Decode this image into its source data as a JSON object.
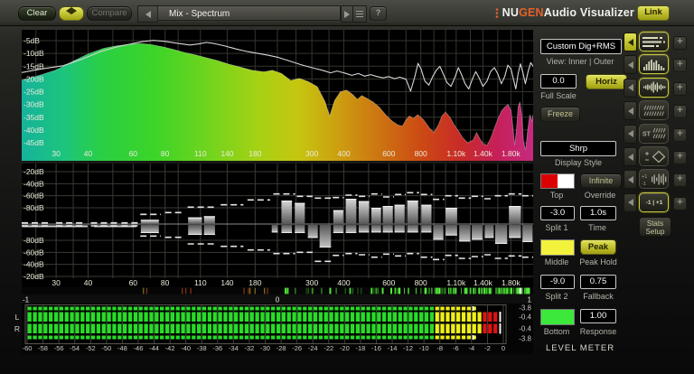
{
  "topbar": {
    "clear": "Clear",
    "compare": "Compare",
    "preset": "Mix - Spectrum",
    "help": "?",
    "brand_prefix": "NU",
    "brand_accent": "GEN",
    "brand_suffix": " Audio Visualizer",
    "link": "Link"
  },
  "freq_axis": {
    "grid": [
      25,
      30,
      35,
      40,
      50,
      60,
      70,
      80,
      90,
      110,
      140,
      180,
      220,
      260,
      300,
      350,
      400,
      500,
      600,
      700,
      800,
      900,
      1000,
      1100,
      1250,
      1400,
      1600,
      1800,
      2000
    ],
    "labels": [
      [
        30,
        "30"
      ],
      [
        40,
        "40"
      ],
      [
        60,
        "60"
      ],
      [
        80,
        "80"
      ],
      [
        110,
        "110"
      ],
      [
        140,
        "140"
      ],
      [
        180,
        "180"
      ],
      [
        300,
        "300"
      ],
      [
        400,
        "400"
      ],
      [
        600,
        "600"
      ],
      [
        800,
        "800"
      ],
      [
        1100,
        "1.10k"
      ],
      [
        1400,
        "1.40k"
      ],
      [
        1800,
        "1.80k"
      ]
    ]
  },
  "spectrum": {
    "db_labels": [
      [
        -5,
        "-5dB"
      ],
      [
        -10,
        "-10dB"
      ],
      [
        -15,
        "-15dB"
      ],
      [
        -20,
        "-20dB"
      ],
      [
        -25,
        "-25dB"
      ],
      [
        -30,
        "-30dB"
      ],
      [
        -35,
        "-35dB"
      ],
      [
        -40,
        "-40dB"
      ],
      [
        -45,
        "-45dB"
      ]
    ],
    "gradient": [
      [
        0,
        "#16b29c"
      ],
      [
        0.08,
        "#1cc47e"
      ],
      [
        0.16,
        "#2ad042"
      ],
      [
        0.26,
        "#3cd428"
      ],
      [
        0.36,
        "#6ed41e"
      ],
      [
        0.46,
        "#a4d214"
      ],
      [
        0.54,
        "#c6c610"
      ],
      [
        0.62,
        "#cc9e10"
      ],
      [
        0.7,
        "#cc7412"
      ],
      [
        0.78,
        "#cc4a14"
      ],
      [
        0.86,
        "#c82a28"
      ],
      [
        0.93,
        "#c6205a"
      ],
      [
        1,
        "#c62a80"
      ]
    ],
    "fill_points": [
      [
        22,
        -20.5
      ],
      [
        26,
        -18.5
      ],
      [
        30,
        -16.5
      ],
      [
        35,
        -13
      ],
      [
        40,
        -10.2
      ],
      [
        46,
        -8
      ],
      [
        52,
        -7
      ],
      [
        58,
        -6.4
      ],
      [
        64,
        -6.1
      ],
      [
        70,
        -6.5
      ],
      [
        78,
        -7.4
      ],
      [
        86,
        -8.4
      ],
      [
        95,
        -9.6
      ],
      [
        105,
        -10.6
      ],
      [
        115,
        -11.6
      ],
      [
        128,
        -12.8
      ],
      [
        142,
        -14.2
      ],
      [
        158,
        -15.4
      ],
      [
        175,
        -16.6
      ],
      [
        195,
        -17.2
      ],
      [
        210,
        -16.6
      ],
      [
        228,
        -17.8
      ],
      [
        248,
        -20.6
      ],
      [
        268,
        -19.8
      ],
      [
        290,
        -21
      ],
      [
        315,
        -23
      ],
      [
        338,
        -29
      ],
      [
        352,
        -34.5
      ],
      [
        368,
        -28.5
      ],
      [
        388,
        -25
      ],
      [
        410,
        -24.4
      ],
      [
        432,
        -26
      ],
      [
        452,
        -28
      ],
      [
        470,
        -26.5
      ],
      [
        492,
        -27.6
      ],
      [
        520,
        -29
      ],
      [
        550,
        -31
      ],
      [
        582,
        -34
      ],
      [
        618,
        -36.5
      ],
      [
        650,
        -38
      ],
      [
        678,
        -38.5
      ],
      [
        700,
        -36
      ],
      [
        722,
        -34.5
      ],
      [
        748,
        -35.5
      ],
      [
        778,
        -34
      ],
      [
        820,
        -36
      ],
      [
        862,
        -39
      ],
      [
        900,
        -41
      ],
      [
        938,
        -38
      ],
      [
        968,
        -34.5
      ],
      [
        1000,
        -33
      ],
      [
        1040,
        -35
      ],
      [
        1080,
        -38
      ],
      [
        1125,
        -40.5
      ],
      [
        1165,
        -43
      ],
      [
        1220,
        -45
      ],
      [
        1280,
        -44
      ],
      [
        1322,
        -41
      ],
      [
        1362,
        -43.5
      ],
      [
        1405,
        -45.5
      ],
      [
        1455,
        -46
      ],
      [
        1505,
        -43
      ],
      [
        1555,
        -39
      ],
      [
        1605,
        -35.5
      ],
      [
        1655,
        -32.5
      ],
      [
        1705,
        -31
      ],
      [
        1755,
        -30
      ],
      [
        1805,
        -32.5
      ],
      [
        1835,
        -39
      ],
      [
        1862,
        -46
      ],
      [
        1892,
        -40
      ],
      [
        1922,
        -31
      ],
      [
        1952,
        -29
      ],
      [
        1985,
        -34
      ],
      [
        2015,
        -44
      ],
      [
        2055,
        -48
      ],
      [
        2095,
        -40
      ],
      [
        2135,
        -34
      ],
      [
        2175,
        -36.5
      ],
      [
        2200,
        -34
      ]
    ],
    "peak_points": [
      [
        22,
        -17.5
      ],
      [
        26,
        -16.2
      ],
      [
        32,
        -14.8
      ],
      [
        38,
        -12.2
      ],
      [
        45,
        -9.2
      ],
      [
        52,
        -7.4
      ],
      [
        58,
        -6.4
      ],
      [
        65,
        -5.4
      ],
      [
        72,
        -4.9
      ],
      [
        80,
        -5.3
      ],
      [
        90,
        -6.1
      ],
      [
        100,
        -6.7
      ],
      [
        108,
        -6.3
      ],
      [
        116,
        -5.7
      ],
      [
        124,
        -6.1
      ],
      [
        136,
        -7
      ],
      [
        152,
        -8.3
      ],
      [
        168,
        -9.3
      ],
      [
        184,
        -10
      ],
      [
        202,
        -10.7
      ],
      [
        222,
        -11.6
      ],
      [
        246,
        -13
      ],
      [
        272,
        -14.4
      ],
      [
        300,
        -15.6
      ],
      [
        330,
        -16.6
      ],
      [
        355,
        -17.6
      ],
      [
        376,
        -16.9
      ],
      [
        400,
        -17.6
      ],
      [
        430,
        -18.6
      ],
      [
        456,
        -17.9
      ],
      [
        482,
        -18.9
      ],
      [
        510,
        -18.3
      ],
      [
        540,
        -19.1
      ],
      [
        570,
        -19.6
      ],
      [
        600,
        -19.1
      ],
      [
        632,
        -19.9
      ],
      [
        662,
        -19.3
      ],
      [
        700,
        -20.1
      ],
      [
        730,
        -24.8
      ],
      [
        758,
        -19.2
      ],
      [
        780,
        -13.9
      ],
      [
        802,
        -16.1
      ],
      [
        830,
        -20.9
      ],
      [
        860,
        -22.4
      ],
      [
        890,
        -19.1
      ],
      [
        920,
        -16.6
      ],
      [
        950,
        -15.1
      ],
      [
        980,
        -18.1
      ],
      [
        1012,
        -21.4
      ],
      [
        1050,
        -22.9
      ],
      [
        1090,
        -19.1
      ],
      [
        1122,
        -15.6
      ],
      [
        1152,
        -18.1
      ],
      [
        1192,
        -21.9
      ],
      [
        1232,
        -23.9
      ],
      [
        1272,
        -20.1
      ],
      [
        1312,
        -17.1
      ],
      [
        1352,
        -19.6
      ],
      [
        1400,
        -22.9
      ],
      [
        1450,
        -20.9
      ],
      [
        1500,
        -17.1
      ],
      [
        1552,
        -15.6
      ],
      [
        1602,
        -18.1
      ],
      [
        1652,
        -21.9
      ],
      [
        1702,
        -19.1
      ],
      [
        1752,
        -14.6
      ],
      [
        1802,
        -16.1
      ],
      [
        1842,
        -20.1
      ],
      [
        1882,
        -23.9
      ],
      [
        1922,
        -17.9
      ],
      [
        1962,
        -14.1
      ],
      [
        2002,
        -17.1
      ],
      [
        2052,
        -21.9
      ],
      [
        2102,
        -17.1
      ],
      [
        2152,
        -13.6
      ],
      [
        2200,
        -15.1
      ]
    ]
  },
  "histogram": {
    "db_labels": [
      [
        -20,
        "-20dB"
      ],
      [
        -40,
        "-40dB"
      ],
      [
        -60,
        "-60dB"
      ],
      [
        -80,
        "-80dB"
      ]
    ],
    "bars": [
      [
        22,
        40,
        null,
        -102
      ],
      [
        42,
        62,
        null,
        -102
      ],
      [
        64,
        76,
        -100,
        -92
      ],
      [
        98,
        112,
        -96,
        -89
      ],
      [
        113,
        126,
        -94,
        -89
      ],
      [
        208,
        222,
        null,
        -93
      ],
      [
        227,
        252,
        -68,
        -92
      ],
      [
        256,
        283,
        -72,
        -92
      ],
      [
        288,
        318,
        null,
        -84
      ],
      [
        320,
        358,
        null,
        -68
      ],
      [
        362,
        400,
        -84,
        -92
      ],
      [
        405,
        450,
        -65,
        -92
      ],
      [
        455,
        505,
        -69,
        -93
      ],
      [
        510,
        562,
        -80,
        -93
      ],
      [
        565,
        625,
        -77,
        -93
      ],
      [
        628,
        695,
        -75,
        -93
      ],
      [
        705,
        785,
        -68,
        -93
      ],
      [
        800,
        885,
        -75,
        -93
      ],
      [
        890,
        985,
        null,
        -81
      ],
      [
        995,
        1115,
        -80,
        -88
      ],
      [
        1125,
        1255,
        null,
        -78
      ],
      [
        1260,
        1400,
        null,
        -81
      ],
      [
        1415,
        1550,
        null,
        -84
      ],
      [
        1555,
        1750,
        null,
        -74
      ],
      [
        1760,
        1980,
        -77,
        -84
      ],
      [
        1990,
        2200,
        null,
        -77
      ]
    ],
    "dashes_up": [
      [
        22,
        28,
        -105
      ],
      [
        30,
        39,
        -105
      ],
      [
        41,
        52,
        -105
      ],
      [
        54,
        63,
        -105
      ],
      [
        64,
        77,
        -91
      ],
      [
        80,
        95,
        -88
      ],
      [
        98,
        127,
        -79
      ],
      [
        132,
        162,
        -75
      ],
      [
        168,
        206,
        -67
      ],
      [
        212,
        258,
        -57
      ],
      [
        262,
        302,
        -61
      ],
      [
        308,
        356,
        -64
      ],
      [
        362,
        400,
        -63
      ],
      [
        406,
        452,
        -59
      ],
      [
        458,
        504,
        -61
      ],
      [
        512,
        564,
        -57
      ],
      [
        570,
        628,
        -62
      ],
      [
        634,
        698,
        -58
      ],
      [
        706,
        788,
        -55
      ],
      [
        800,
        888,
        -58
      ],
      [
        892,
        988,
        -66
      ],
      [
        996,
        1118,
        -60
      ],
      [
        1126,
        1258,
        -64
      ],
      [
        1264,
        1402,
        -61
      ],
      [
        1418,
        1552,
        -65
      ],
      [
        1558,
        1752,
        -60
      ],
      [
        1762,
        1982,
        -57
      ],
      [
        1992,
        2200,
        -60
      ]
    ],
    "dashes_down": [
      [
        22,
        28,
        -104
      ],
      [
        30,
        39,
        -104
      ],
      [
        41,
        52,
        -104
      ],
      [
        54,
        63,
        -104
      ],
      [
        64,
        77,
        -87
      ],
      [
        80,
        95,
        -85
      ],
      [
        98,
        127,
        -74
      ],
      [
        132,
        162,
        -70
      ],
      [
        168,
        206,
        -64
      ],
      [
        212,
        258,
        -58
      ],
      [
        262,
        302,
        -60
      ],
      [
        308,
        356,
        -45
      ],
      [
        362,
        400,
        -55
      ],
      [
        406,
        452,
        -58
      ],
      [
        458,
        504,
        -56
      ],
      [
        512,
        564,
        -52
      ],
      [
        570,
        628,
        -57
      ],
      [
        634,
        698,
        -54
      ],
      [
        706,
        788,
        -58
      ],
      [
        800,
        888,
        -52
      ],
      [
        892,
        988,
        -48
      ],
      [
        996,
        1118,
        -55
      ],
      [
        1126,
        1258,
        -50
      ],
      [
        1264,
        1402,
        -53
      ],
      [
        1418,
        1552,
        -56
      ],
      [
        1558,
        1752,
        -50
      ],
      [
        1762,
        1982,
        -54
      ],
      [
        1992,
        2200,
        -52
      ]
    ]
  },
  "correlation": {
    "min_label": "-1",
    "mid_label": "0",
    "max_label": "1",
    "current": 0.95
  },
  "meter": {
    "channels": [
      "L",
      "R"
    ],
    "ticks": [
      "-60",
      "-58",
      "-56",
      "-54",
      "-52",
      "-50",
      "-48",
      "-46",
      "-44",
      "-42",
      "-40",
      "-38",
      "-36",
      "-34",
      "-32",
      "-30",
      "-28",
      "-26",
      "-24",
      "-22",
      "-20",
      "-18",
      "-16",
      "-14",
      "-12",
      "-10",
      "-8",
      "-6",
      "-4",
      "-2",
      "0"
    ],
    "readouts": [
      "-3.8",
      "-0.4",
      "-0.4",
      "-3.8"
    ],
    "rms_db": -3.8,
    "peak_db": -0.4,
    "bar_end_db": -1.0,
    "split1": -3.0,
    "split2": -9.0,
    "colors": {
      "low": "#28dc28",
      "mid": "#eeee1c",
      "high": "#dc1414"
    }
  },
  "panel": {
    "preset": "Custom Dig+RMS",
    "view": "View: Inner | Outer",
    "full_scale_value": "0.0",
    "horiz": "Horiz",
    "full_scale_label": "Full Scale",
    "freeze": "Freeze",
    "display_style_value": "Shrp",
    "display_style_label": "Display Style",
    "top_label": "Top",
    "override_btn": "Infinite",
    "override_label": "Override",
    "split1_value": "-3.0",
    "split1_label": "Split 1",
    "time_value": "1.0s",
    "time_label": "Time",
    "middle_label": "Middle",
    "peak_btn": "Peak",
    "peak_label": "Peak Hold",
    "split2_value": "-9.0",
    "split2_label": "Split 2",
    "fallback_value": "0.75",
    "fallback_label": "Fallback",
    "bottom_label": "Bottom",
    "response_value": "1.00",
    "response_label": "Response",
    "section_label": "LEVEL METER",
    "top_swatch": [
      "#dd0000",
      "#ffffff"
    ],
    "middle_swatch": "#f2f23c",
    "bottom_swatch": "#3ce83c"
  },
  "views": {
    "plus": "+",
    "stats_line1": "Stats",
    "stats_line2": "Setup",
    "items": [
      {
        "name": "level-meters",
        "active": true,
        "arrow_active": true
      },
      {
        "name": "histogram",
        "active": true
      },
      {
        "name": "waveform",
        "active": true
      },
      {
        "name": "spectrogram",
        "active": false
      },
      {
        "name": "stereo-spectrogram",
        "active": false,
        "text": "ST"
      },
      {
        "name": "vectorscope",
        "active": false
      },
      {
        "name": "correlation-spectrum",
        "active": false,
        "text_top": "+1",
        "text_bottom": "-1"
      },
      {
        "name": "correlation-meter",
        "active": true,
        "text": "-1 | +1"
      }
    ]
  }
}
